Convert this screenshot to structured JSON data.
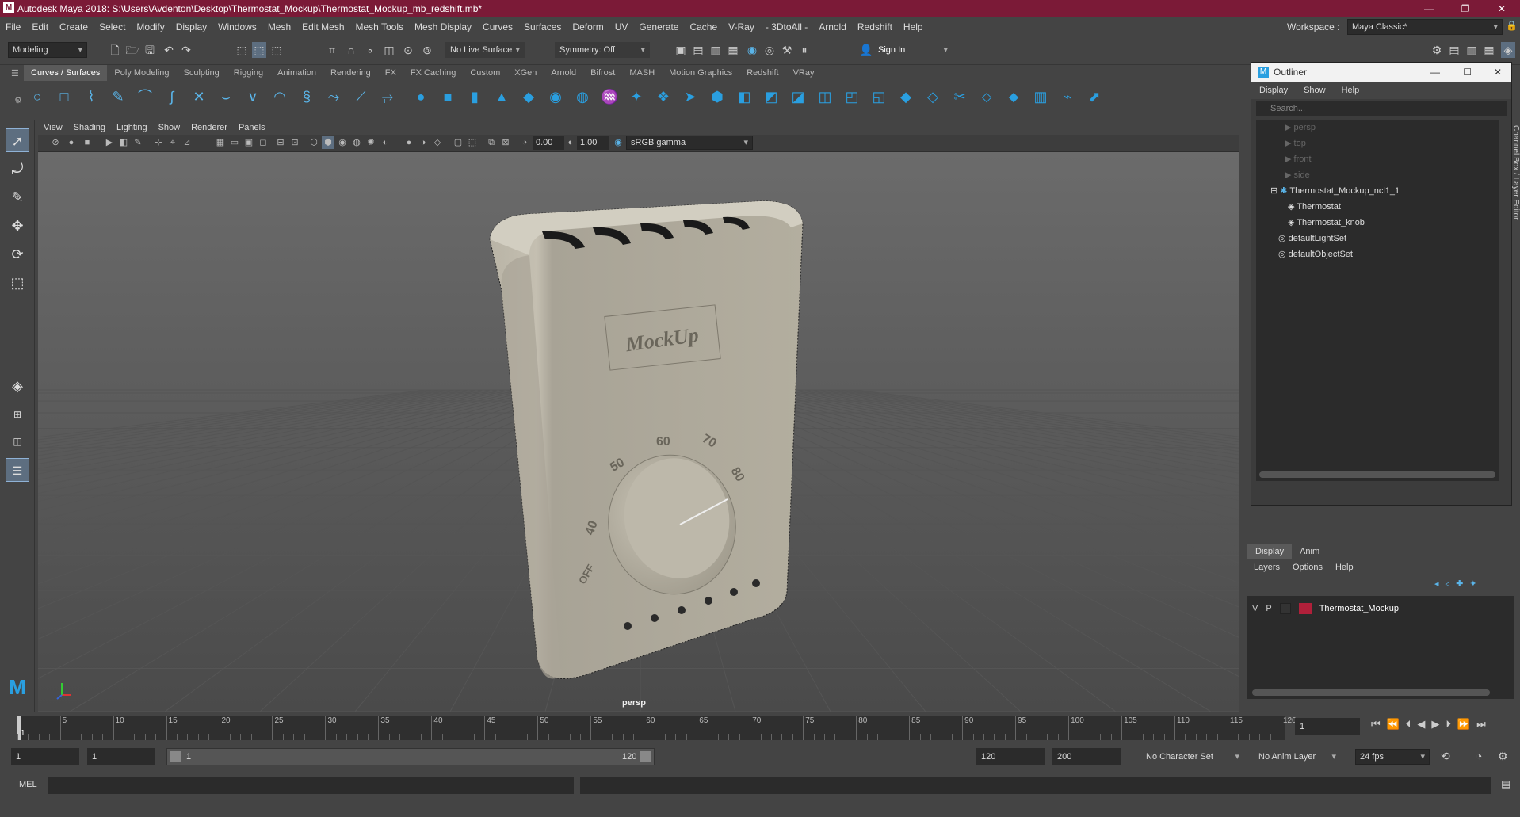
{
  "titlebar": {
    "title": "Autodesk Maya 2018: S:\\Users\\Avdenton\\Desktop\\Thermostat_Mockup\\Thermostat_Mockup_mb_redshift.mb*"
  },
  "menus": [
    "File",
    "Edit",
    "Create",
    "Select",
    "Modify",
    "Display",
    "Windows",
    "Mesh",
    "Edit Mesh",
    "Mesh Tools",
    "Mesh Display",
    "Curves",
    "Surfaces",
    "Deform",
    "UV",
    "Generate",
    "Cache",
    "V-Ray",
    "- 3DtoAll -",
    "Arnold",
    "Redshift",
    "Help"
  ],
  "workspace": {
    "label": "Workspace :",
    "value": "Maya Classic*"
  },
  "statusline": {
    "mode": "Modeling",
    "live_surface": "No Live Surface",
    "symmetry": "Symmetry: Off",
    "sign_in": "Sign In"
  },
  "shelf": {
    "tabs": [
      "Curves / Surfaces",
      "Poly Modeling",
      "Sculpting",
      "Rigging",
      "Animation",
      "Rendering",
      "FX",
      "FX Caching",
      "Custom",
      "XGen",
      "Arnold",
      "Bifrost",
      "MASH",
      "Motion Graphics",
      "Redshift",
      "VRay"
    ],
    "active": "Curves / Surfaces"
  },
  "viewport": {
    "menus": [
      "View",
      "Shading",
      "Lighting",
      "Show",
      "Renderer",
      "Panels"
    ],
    "exposure": "0.00",
    "gamma": "1.00",
    "colorspace": "sRGB gamma",
    "camera_label": "persp",
    "mockup_text": "MockUp",
    "dial_labels": [
      "60",
      "70",
      "50",
      "80",
      "40",
      "OFF"
    ]
  },
  "outliner": {
    "title": "Outliner",
    "menus": [
      "Display",
      "Show",
      "Help"
    ],
    "search_placeholder": "Search...",
    "items": [
      {
        "label": "persp",
        "dim": true
      },
      {
        "label": "top",
        "dim": true
      },
      {
        "label": "front",
        "dim": true
      },
      {
        "label": "side",
        "dim": true
      },
      {
        "label": "Thermostat_Mockup_ncl1_1"
      },
      {
        "label": "Thermostat"
      },
      {
        "label": "Thermostat_knob"
      },
      {
        "label": "defaultLightSet"
      },
      {
        "label": "defaultObjectSet"
      }
    ]
  },
  "side_strip": "Channel Box / Layer Editor",
  "layers": {
    "tabs": [
      "Display",
      "Anim"
    ],
    "menus": [
      "Layers",
      "Options",
      "Help"
    ],
    "row": {
      "v": "V",
      "p": "P",
      "name": "Thermostat_Mockup",
      "color": "#b0203a"
    }
  },
  "timeline": {
    "ticks": [
      "5",
      "10",
      "15",
      "20",
      "25",
      "30",
      "35",
      "40",
      "45",
      "50",
      "55",
      "60",
      "65",
      "70",
      "75",
      "80",
      "85",
      "90",
      "95",
      "100",
      "105",
      "110",
      "115",
      "120"
    ],
    "current_frame": "1",
    "current_field": "1"
  },
  "range": {
    "start": "1",
    "start2": "1",
    "slider_start": "1",
    "slider_end": "120",
    "end": "120",
    "end2": "200",
    "character_set": "No Character Set",
    "anim_layer": "No Anim Layer",
    "fps": "24 fps"
  },
  "cmdline": {
    "label": "MEL"
  }
}
